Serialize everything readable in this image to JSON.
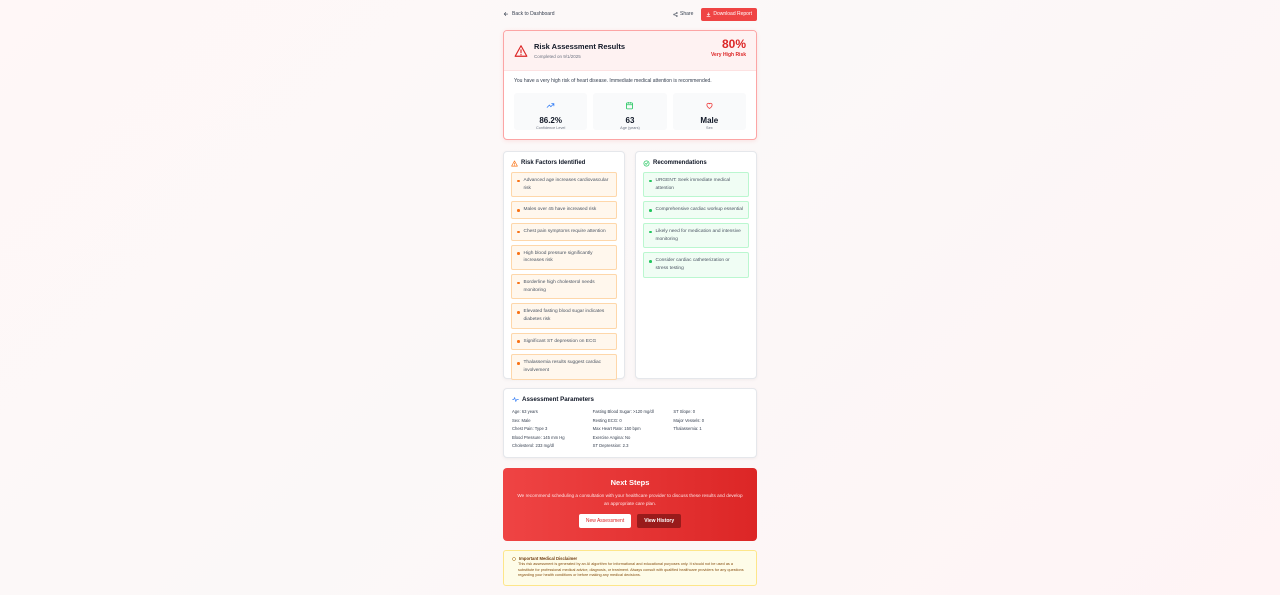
{
  "topbar": {
    "back_label": "Back to Dashboard",
    "share_label": "Share",
    "download_label": "Download Report"
  },
  "result": {
    "title": "Risk Assessment Results",
    "completed": "Completed on 9/1/2025",
    "percent": "80%",
    "level": "Very High Risk",
    "message": "You have a very high risk of heart disease. Immediate medical attention is recommended.",
    "stats": [
      {
        "value": "86.2%",
        "label": "Confidence Level",
        "icon": "trending-up-icon"
      },
      {
        "value": "63",
        "label": "Age (years)",
        "icon": "calendar-icon"
      },
      {
        "value": "Male",
        "label": "Sex",
        "icon": "heart-icon"
      }
    ]
  },
  "risk_factors": {
    "title": "Risk Factors Identified",
    "items": [
      "Advanced age increases cardiovascular risk",
      "Males over 45 have increased risk",
      "Chest pain symptoms require attention",
      "High blood pressure significantly increases risk",
      "Borderline high cholesterol needs monitoring",
      "Elevated fasting blood sugar indicates diabetes risk",
      "Significant ST depression on ECG",
      "Thalassemia results suggest cardiac involvement"
    ]
  },
  "recommendations": {
    "title": "Recommendations",
    "items": [
      "URGENT: Seek immediate medical attention",
      "Comprehensive cardiac workup essential",
      "Likely need for medication and intensive monitoring",
      "Consider cardiac catheterization or stress testing"
    ]
  },
  "parameters": {
    "title": "Assessment Parameters",
    "col1": [
      "Age: 63 years",
      "Sex: Male",
      "Chest Pain: Type 3",
      "Blood Pressure: 145 mm Hg",
      "Cholesterol: 233 mg/dl"
    ],
    "col2": [
      "Fasting Blood Sugar: >120 mg/dl",
      "Resting ECG: 0",
      "Max Heart Rate: 150 bpm",
      "Exercise Angina: No",
      "ST Depression: 2.3"
    ],
    "col3": [
      "ST Slope: 0",
      "Major Vessels: 0",
      "Thalassemia: 1"
    ]
  },
  "next_steps": {
    "title": "Next Steps",
    "text": "We recommend scheduling a consultation with your healthcare provider to discuss these results and develop an appropriate care plan.",
    "new_label": "New Assessment",
    "history_label": "View History"
  },
  "disclaimer": {
    "title": "Important Medical Disclaimer",
    "text": "This risk assessment is generated by an AI algorithm for informational and educational purposes only. It should not be used as a substitute for professional medical advice, diagnosis, or treatment. Always consult with qualified healthcare providers for any questions regarding your health conditions or before making any medical decisions."
  },
  "colors": {
    "accent": "#ef4444",
    "risk": "#f97316",
    "recommendation": "#22c55e"
  }
}
